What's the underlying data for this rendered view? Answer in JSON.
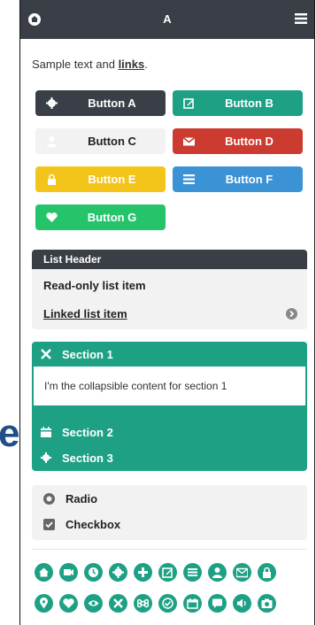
{
  "header": {
    "title": "A"
  },
  "intro": {
    "text": "Sample text and ",
    "link": "links",
    "end": "."
  },
  "buttons": [
    {
      "label": "Button A",
      "color": "#3a3f47",
      "icon": "gear-icon"
    },
    {
      "label": "Button B",
      "color": "#1ea085",
      "icon": "edit-icon"
    },
    {
      "label": "Button C",
      "color": "#f2f2f2",
      "icon": "user-icon"
    },
    {
      "label": "Button D",
      "color": "#cc3b30",
      "icon": "mail-icon"
    },
    {
      "label": "Button E",
      "color": "#f3c41a",
      "icon": "lock-icon"
    },
    {
      "label": "Button F",
      "color": "#3b93d6",
      "icon": "list-icon"
    },
    {
      "label": "Button G",
      "color": "#25c46b",
      "icon": "heart-icon"
    }
  ],
  "listview": {
    "header": "List Header",
    "items": [
      "Read-only list item",
      "Linked list item"
    ]
  },
  "collapsible": {
    "sections": [
      "Section 1",
      "Section 2",
      "Section 3"
    ],
    "content": "I'm the collapsible content for section 1"
  },
  "controls": {
    "radio": "Radio",
    "checkbox": "Checkbox"
  },
  "icon_grid": {
    "row1": [
      "home-icon",
      "video-icon",
      "clock-icon",
      "gear-icon",
      "plus-icon",
      "edit-icon",
      "list-icon",
      "user-icon",
      "mail-icon",
      "lock-icon"
    ],
    "row2": [
      "location-icon",
      "heart-icon",
      "eye-icon",
      "close-icon",
      "command-icon",
      "check-icon",
      "calendar-icon",
      "comment-icon",
      "audio-icon",
      "camera-icon"
    ]
  },
  "page_fragment": {
    "letter": "e"
  }
}
